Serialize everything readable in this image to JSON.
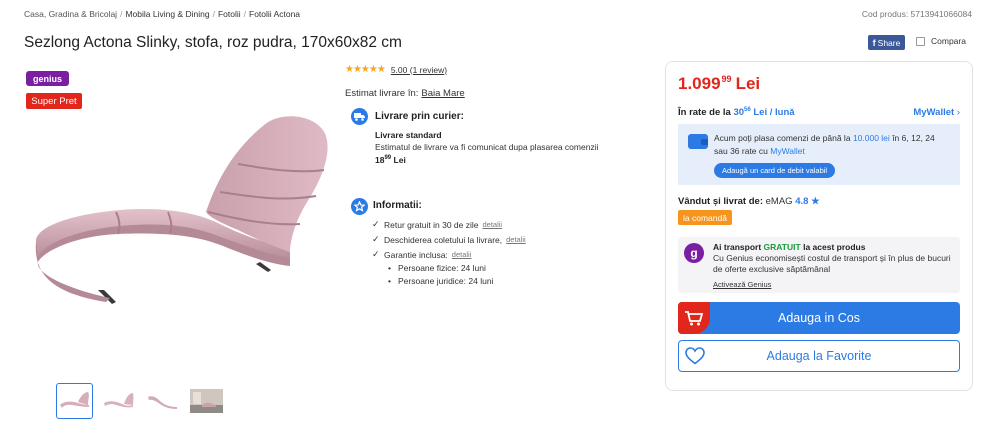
{
  "breadcrumb": [
    "Casa, Gradina & Bricolaj",
    "Mobila Living & Dining",
    "Fotolii",
    "Fotolii Actona"
  ],
  "product_code": "Cod produs: 5713941066084",
  "title": "Sezlong Actona Slinky, stofa, roz pudra, 170x60x82 cm",
  "share_label": "Share",
  "compare_label": "Compara",
  "badges": {
    "genius": "genius",
    "super_pret": "Super Pret"
  },
  "rating": {
    "stars": "★★★★★",
    "text": "5.00 (1 review)"
  },
  "delivery_estimate": {
    "label": "Estimat livrare în:",
    "city": "Baia Mare"
  },
  "courier": {
    "heading": "Livrare prin curier:",
    "type": "Livrare standard",
    "note": "Estimatul de livrare va fi comunicat dupa plasarea comenzii",
    "price_int": "18",
    "price_dec": "99",
    "currency": "Lei"
  },
  "info": {
    "heading": "Informatii:",
    "details_label": "detalii",
    "items": [
      "Retur gratuit in 30 de zile",
      "Deschiderea coletului la livrare,",
      "Garantie inclusa:"
    ],
    "warranty": [
      "Persoane fizice: 24 luni",
      "Persoane juridice: 24 luni"
    ]
  },
  "price": {
    "int": "1.099",
    "dec": "99",
    "currency": "Lei"
  },
  "installments": {
    "prefix": "În rate de la",
    "amount": "30",
    "amount_dec": "56",
    "suffix": "Lei / lună",
    "wallet_link": "MyWallet"
  },
  "wallet_box": {
    "t1": "Acum poți plasa comenzi de până la",
    "limit": "10.000 lei",
    "t2": "în 6, 12, 24 sau 36 rate cu",
    "brand": "MyWallet",
    "button": "Adaugă un card de debit valabil"
  },
  "seller": {
    "label": "Vândut și livrat de:",
    "name": "eMAG",
    "score": "4.8 ★",
    "tag": "la comandă"
  },
  "genius_box": {
    "t1": "Ai transport",
    "free": "GRATUIT",
    "t2": "la acest produs",
    "desc": "Cu Genius economisești costul de transport și în plus de bucuri de oferte exclusive săptămânal",
    "link": "Activează Genius",
    "icon_letter": "g"
  },
  "cart_button": "Adauga in Cos",
  "fav_button": "Adauga la Favorite",
  "colors": {
    "primary": "#2c7be5",
    "accent_red": "#e1261c",
    "genius": "#7a1fa2",
    "chair": "#d9b1bc",
    "orange": "#f7941d"
  }
}
